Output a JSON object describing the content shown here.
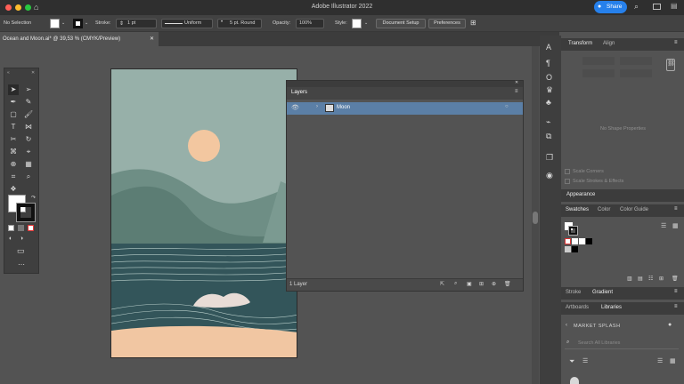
{
  "app": {
    "title": "Adobe Illustrator 2022",
    "share_label": "Share"
  },
  "controlbar": {
    "selection": "No Selection",
    "stroke_label": "Stroke:",
    "stroke_weight": "1 pt",
    "profile": "Uniform",
    "brush": "5 pt. Round",
    "opacity_label": "Opacity:",
    "opacity_value": "100%",
    "style_label": "Style:",
    "document_setup": "Document Setup",
    "preferences": "Preferences"
  },
  "document": {
    "tab_title": "Ocean and Moon.ai* @ 39,53 % (CMYK/Preview)"
  },
  "layers_panel": {
    "title": "Layers",
    "layers": [
      {
        "name": "Moon"
      }
    ],
    "footer_count": "1 Layer"
  },
  "right_panel": {
    "transform_tabs": [
      "Transform",
      "Align"
    ],
    "no_shape": "No Shape Properties",
    "scale_corners": "Scale Corners",
    "scale_strokes": "Scale Strokes & Effects",
    "appearance": "Appearance",
    "swatch_tabs": [
      "Swatches",
      "Color",
      "Color Guide"
    ],
    "stroke_tabs": [
      "Stroke",
      "Gradient"
    ],
    "artboard_tabs": [
      "Artboards",
      "Libraries"
    ],
    "library_name": "MARKET SPLASH",
    "search_placeholder": "Search All Libraries"
  },
  "colors": {
    "sky": "#97b0a9",
    "moon": "#f3c7a0",
    "hill_back": "#6e8e85",
    "hill_front": "#5c7d74",
    "sea": "#33555a",
    "foam": "#e8dcd6",
    "sand": "#f1c6a2",
    "accent": "#2680eb"
  }
}
